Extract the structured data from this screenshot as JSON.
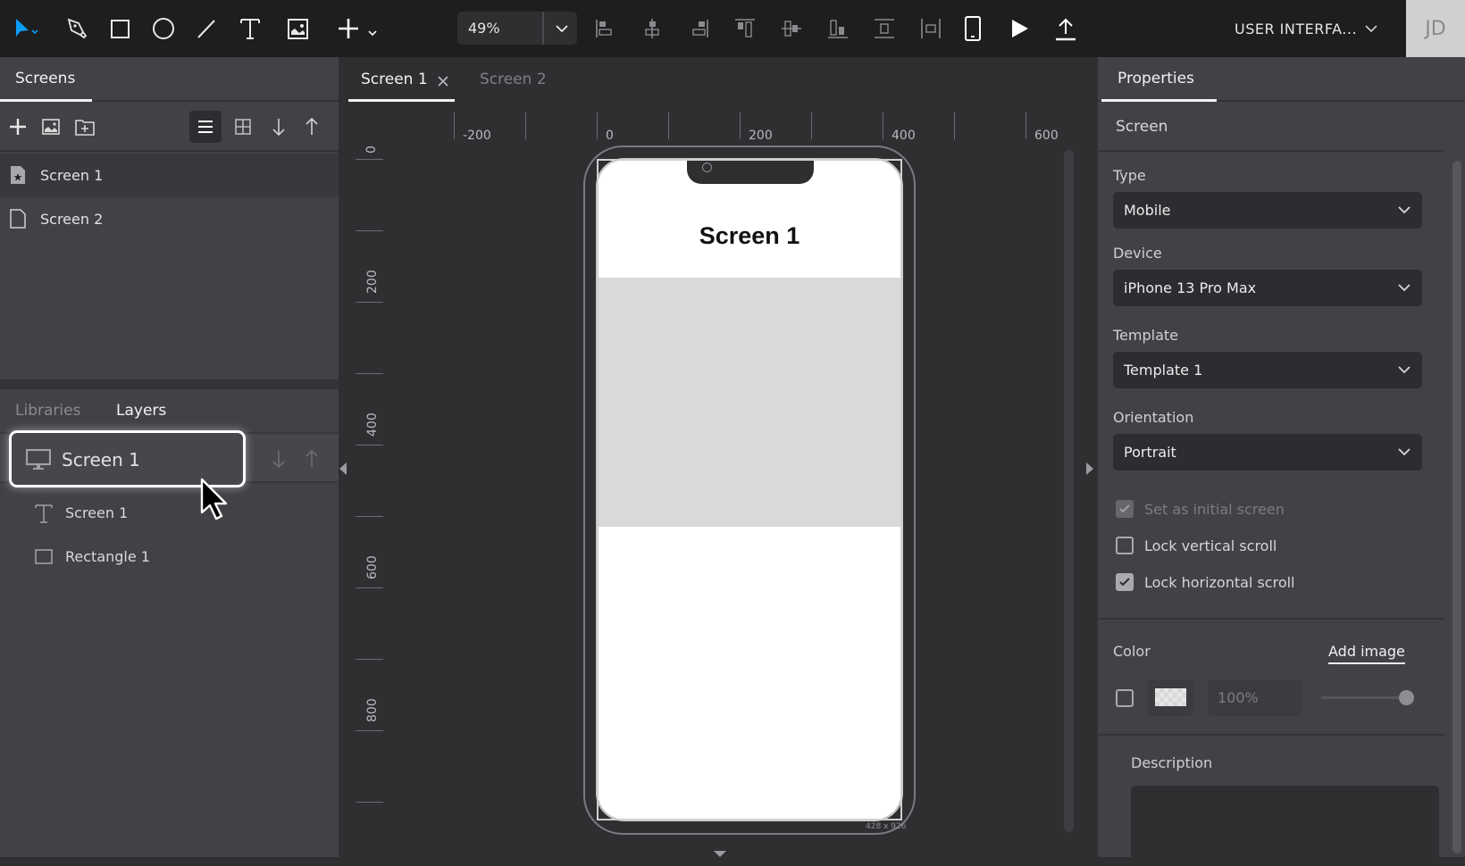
{
  "toolbar": {
    "tools": [
      "select-tool",
      "pen-tool",
      "rectangle-tool",
      "ellipse-tool",
      "line-tool",
      "text-tool",
      "image-tool",
      "add-tool"
    ],
    "zoom_value": "49%",
    "align_tools": [
      "align-left",
      "align-center-horizontal",
      "align-right",
      "align-top",
      "align-center-vertical",
      "align-bottom",
      "distribute-vertical",
      "distribute-horizontal"
    ],
    "device_preview": "mobile-device-icon",
    "play": "play-icon",
    "export": "upload-icon",
    "project_name": "USER INTERFA...",
    "avatar_initials": "JD",
    "accent_color": "#0a9cf5"
  },
  "left_panel": {
    "screens_tab": "Screens",
    "screens": [
      {
        "label": "Screen 1",
        "icon": "starred-page-icon",
        "selected": true
      },
      {
        "label": "Screen 2",
        "icon": "page-icon",
        "selected": false
      }
    ],
    "lower_tabs": [
      {
        "label": "Libraries",
        "active": false
      },
      {
        "label": "Layers",
        "active": true
      }
    ],
    "layers": [
      {
        "label": "Screen 1",
        "icon": "monitor-icon",
        "selected": true
      },
      {
        "label": "Screen 1",
        "icon": "text-icon"
      },
      {
        "label": "Rectangle 1",
        "icon": "rectangle-icon"
      }
    ]
  },
  "canvas": {
    "tabs": [
      {
        "label": "Screen 1",
        "active": true,
        "closable": true
      },
      {
        "label": "Screen 2",
        "active": false
      }
    ],
    "ruler_h": [
      "-200",
      "0",
      "200",
      "400",
      "600"
    ],
    "ruler_v": [
      "0",
      "200",
      "400",
      "600",
      "800"
    ],
    "screen_title": "Screen 1",
    "size_label": "428 x 926"
  },
  "right_panel": {
    "tab": "Properties",
    "section": "Screen",
    "fields": [
      {
        "label": "Type",
        "value": "Mobile"
      },
      {
        "label": "Device",
        "value": "iPhone 13 Pro Max"
      },
      {
        "label": "Template",
        "value": "Template 1"
      },
      {
        "label": "Orientation",
        "value": "Portrait"
      }
    ],
    "checkboxes": [
      {
        "label": "Set as initial screen",
        "checked": true,
        "disabled": true
      },
      {
        "label": "Lock vertical scroll",
        "checked": false,
        "disabled": false
      },
      {
        "label": "Lock horizontal scroll",
        "checked": true,
        "disabled": false
      }
    ],
    "color_label": "Color",
    "add_image_label": "Add image",
    "color_enabled": false,
    "opacity_value": "100%",
    "opacity_slider_fraction": 1.0,
    "description_label": "Description",
    "description_value": ""
  }
}
